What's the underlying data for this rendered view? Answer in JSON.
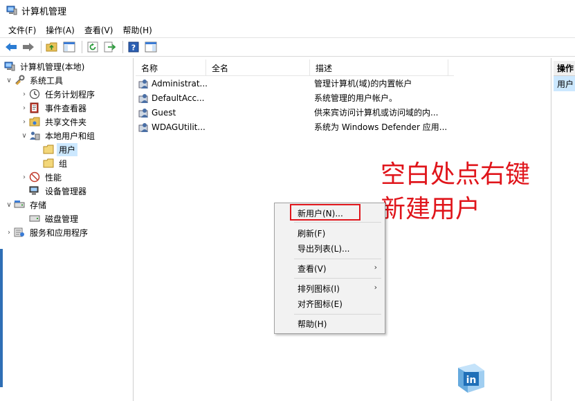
{
  "window": {
    "title": "计算机管理"
  },
  "menubar": {
    "items": [
      "文件(F)",
      "操作(A)",
      "查看(V)",
      "帮助(H)"
    ]
  },
  "toolbar": {
    "buttons": [
      "back-arrow-icon",
      "forward-arrow-icon",
      "up-folder-icon",
      "show-hide-tree-icon",
      "refresh-icon",
      "export-list-icon",
      "help-icon",
      "properties-pane-icon"
    ]
  },
  "tree": {
    "root": "计算机管理(本地)",
    "items": [
      {
        "label": "系统工具",
        "expanded": true
      },
      {
        "label": "任务计划程序"
      },
      {
        "label": "事件查看器"
      },
      {
        "label": "共享文件夹"
      },
      {
        "label": "本地用户和组",
        "expanded": true
      },
      {
        "label": "用户",
        "selected": true
      },
      {
        "label": "组"
      },
      {
        "label": "性能"
      },
      {
        "label": "设备管理器"
      },
      {
        "label": "存储",
        "expanded": true
      },
      {
        "label": "磁盘管理"
      },
      {
        "label": "服务和应用程序"
      }
    ]
  },
  "list": {
    "columns": [
      "名称",
      "全名",
      "描述"
    ],
    "rows": [
      {
        "name": "Administrat...",
        "fullname": "",
        "description": "管理计算机(域)的内置帐户"
      },
      {
        "name": "DefaultAcc...",
        "fullname": "",
        "description": "系统管理的用户帐户。"
      },
      {
        "name": "Guest",
        "fullname": "",
        "description": "供来宾访问计算机或访问域的内..."
      },
      {
        "name": "WDAGUtilit...",
        "fullname": "",
        "description": "系统为 Windows Defender 应用..."
      }
    ]
  },
  "actions": {
    "header": "操作",
    "selected": "用户"
  },
  "context_menu": {
    "items": [
      {
        "label": "新用户(N)...",
        "highlighted": true
      },
      {
        "label": "刷新(F)"
      },
      {
        "label": "导出列表(L)..."
      },
      {
        "label": "查看(V)",
        "submenu": true
      },
      {
        "label": "排列图标(I)",
        "submenu": true
      },
      {
        "label": "对齐图标(E)"
      },
      {
        "label": "帮助(H)"
      }
    ]
  },
  "annotation": {
    "line1": "空白处点右键",
    "line2": "新建用户"
  },
  "watermark": {
    "text": "in"
  },
  "colors": {
    "highlight_red": "#e0151b",
    "selection_blue": "#cce8ff",
    "menu_bg": "#f2f2f2"
  }
}
